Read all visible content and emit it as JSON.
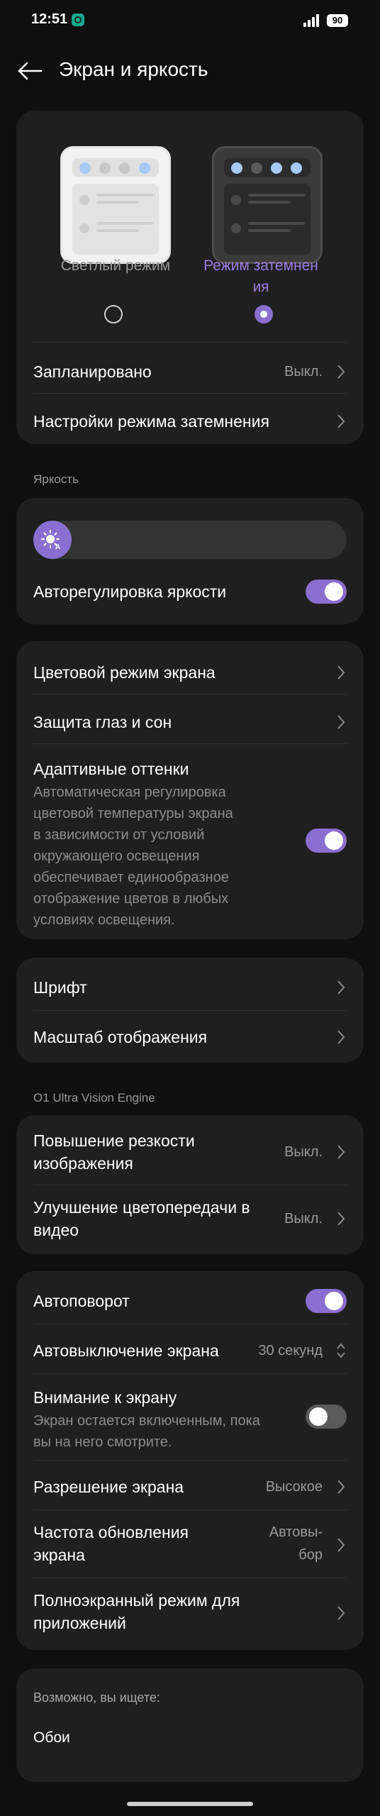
{
  "status": {
    "time": "12:51",
    "battery": "90"
  },
  "header": {
    "title": "Экран и яркость"
  },
  "theme": {
    "light_label": "Светлый режим",
    "dark_label": "Режим затемнения",
    "selected": "dark",
    "scheduled_label": "Запланировано",
    "scheduled_value": "Выкл.",
    "dark_settings_label": "Настройки режима затемнения"
  },
  "brightness": {
    "section_label": "Яркость",
    "level": 0.0,
    "auto_label": "Авторегулировка яркости",
    "auto_on": true
  },
  "color": {
    "color_mode_label": "Цветовой режим экрана",
    "eye_protection_label": "Защита глаз и сон",
    "adaptive_label": "Адаптивные оттенки",
    "adaptive_desc_lines": [
      "Автоматическая регулировка",
      "цветовой температуры экрана",
      "в зависимости от условий",
      "окружающего освещения",
      "обеспечивает единообразное",
      "отображение цветов в любых",
      "условиях освещения."
    ],
    "adaptive_on": true
  },
  "font": {
    "font_label": "Шрифт",
    "scale_label": "Масштаб отображения"
  },
  "vision": {
    "section_label": "O1 Ultra Vision Engine",
    "sharpness_lines": [
      "Повышение резкости",
      "изображения"
    ],
    "sharpness_value": "Выкл.",
    "video_color_lines": [
      "Улучшение цветопередачи в",
      "видео"
    ],
    "video_color_value": "Выкл."
  },
  "screen": {
    "autorotate_label": "Автоповорот",
    "autorotate_on": true,
    "timeout_label": "Автовыключение экрана",
    "timeout_value": "30 секунд",
    "attention_label": "Внимание к экрану",
    "attention_desc_lines": [
      "Экран остается включенным, пока",
      "вы на него смотрите."
    ],
    "attention_on": false,
    "resolution_label": "Разрешение экрана",
    "resolution_value": "Высокое",
    "refresh_lines": [
      "Частота обновления",
      "экрана"
    ],
    "refresh_value_lines": [
      "Автовы-",
      "бор"
    ],
    "fullscreen_lines": [
      "Полноэкранный режим для",
      "приложений"
    ]
  },
  "suggest": {
    "title": "Возможно, вы ищете:",
    "item": "Обои"
  },
  "colors": {
    "accent": "#8b6fd0",
    "card": "#1f1f1f",
    "background": "#0f0f0f"
  }
}
